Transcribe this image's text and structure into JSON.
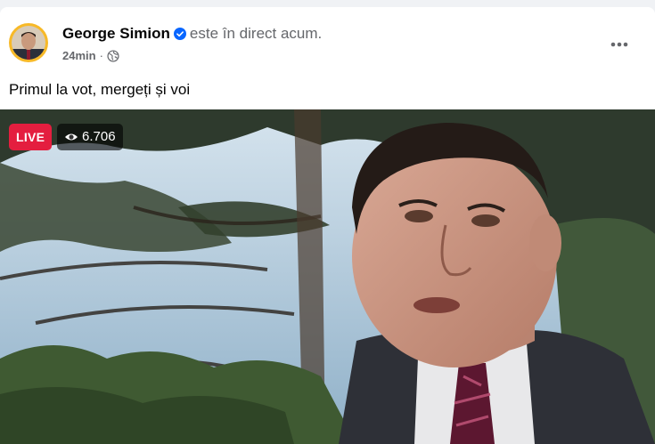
{
  "post": {
    "author_name": "George Simion",
    "status_text": "este în direct acum.",
    "time": "24min",
    "separator": "·",
    "text": "Primul la vot, mergeți și voi"
  },
  "video": {
    "live_label": "LIVE",
    "viewer_count": "6.706"
  },
  "icons": {
    "verified": "verified-badge-icon",
    "privacy": "globe-icon",
    "more": "more-options-icon",
    "viewers": "eye-icon"
  },
  "colors": {
    "live_red": "#e41e3f",
    "verified_blue": "#0866ff",
    "avatar_ring": "#f7b928",
    "secondary_text": "#65676b"
  }
}
